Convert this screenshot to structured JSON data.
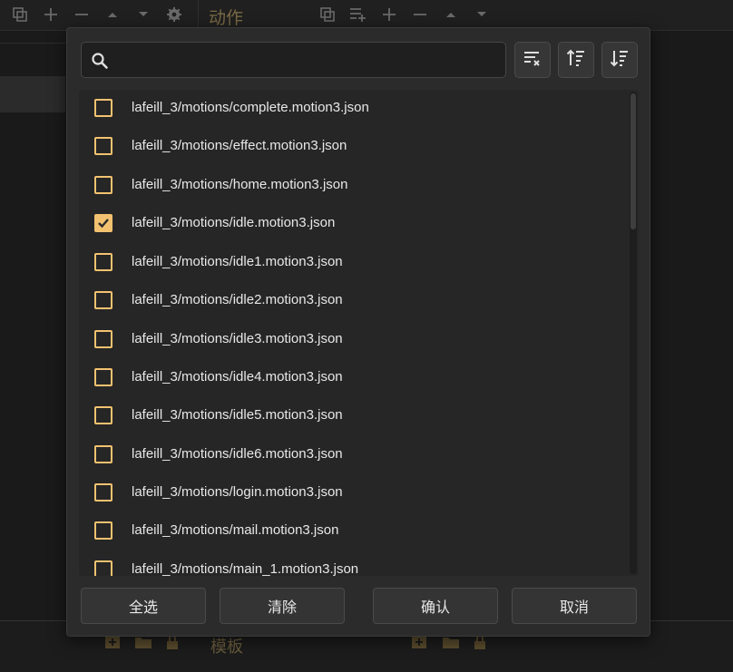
{
  "background": {
    "panel_title": "动作",
    "bottom_title": "模板"
  },
  "dialog": {
    "search": {
      "value": "",
      "placeholder": ""
    },
    "tools": [
      {
        "name": "clear-filter",
        "icon": "filter-clear-icon"
      },
      {
        "name": "sort-ascending",
        "icon": "sort-ascending-icon"
      },
      {
        "name": "sort-descending",
        "icon": "sort-descending-icon"
      }
    ],
    "items": [
      {
        "label": "lafeill_3/motions/complete.motion3.json",
        "checked": false
      },
      {
        "label": "lafeill_3/motions/effect.motion3.json",
        "checked": false
      },
      {
        "label": "lafeill_3/motions/home.motion3.json",
        "checked": false
      },
      {
        "label": "lafeill_3/motions/idle.motion3.json",
        "checked": true
      },
      {
        "label": "lafeill_3/motions/idle1.motion3.json",
        "checked": false
      },
      {
        "label": "lafeill_3/motions/idle2.motion3.json",
        "checked": false
      },
      {
        "label": "lafeill_3/motions/idle3.motion3.json",
        "checked": false
      },
      {
        "label": "lafeill_3/motions/idle4.motion3.json",
        "checked": false
      },
      {
        "label": "lafeill_3/motions/idle5.motion3.json",
        "checked": false
      },
      {
        "label": "lafeill_3/motions/idle6.motion3.json",
        "checked": false
      },
      {
        "label": "lafeill_3/motions/login.motion3.json",
        "checked": false
      },
      {
        "label": "lafeill_3/motions/mail.motion3.json",
        "checked": false
      },
      {
        "label": "lafeill_3/motions/main_1.motion3.json",
        "checked": false
      }
    ],
    "buttons": {
      "select_all": "全选",
      "clear": "清除",
      "confirm": "确认",
      "cancel": "取消"
    }
  },
  "colors": {
    "accent": "#f3c270",
    "dialog_bg": "#2b2b2b",
    "list_bg": "#262626"
  }
}
